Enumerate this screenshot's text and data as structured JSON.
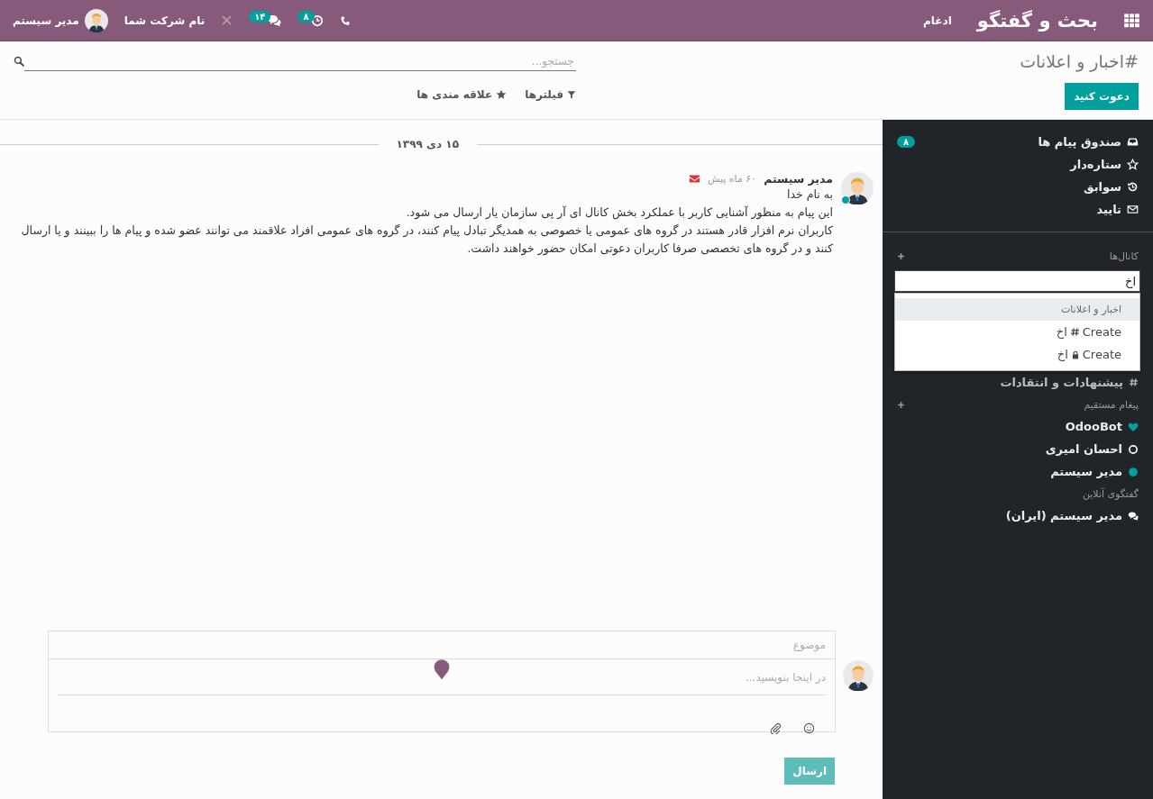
{
  "navbar": {
    "app_title": "بحث و گفتگو",
    "menu_items": [
      "ادغام"
    ],
    "activity_count": "۸",
    "messages_count": "۱۴",
    "company": "نام شرکت شما",
    "user": "مدیر سیستم"
  },
  "control_panel": {
    "title": "#اخبار و اعلانات",
    "invite_button": "دعوت کنید",
    "search": {
      "placeholder": "جستجو..."
    },
    "filters": [
      {
        "kind": "filter",
        "label": "فیلترها"
      },
      {
        "kind": "favorites",
        "label": "علاقه مندی ها"
      }
    ]
  },
  "sidebar": {
    "mailboxes": [
      {
        "kind": "inbox",
        "label": "صندوق پیام ها",
        "counter": "۸"
      },
      {
        "kind": "starred",
        "label": "ستاره‌دار"
      },
      {
        "kind": "history",
        "label": "سوابق"
      },
      {
        "kind": "moderation",
        "label": "تایید"
      }
    ],
    "channels": {
      "heading": "کانال‌ها",
      "search_value": "اخ",
      "suggestions": [
        {
          "kind": "match",
          "label": "اخبار و اعلانات",
          "selected": true
        },
        {
          "kind": "create_public",
          "label": "Create",
          "name": "اخ",
          "selected": false
        },
        {
          "kind": "create_private",
          "label": "Create",
          "name": "اخ",
          "selected": false
        }
      ],
      "items": [
        {
          "label": "پیشنهادات و انتقادات"
        }
      ]
    },
    "direct": {
      "heading": "پیغام مستقیم",
      "items": [
        {
          "kind": "bot",
          "label": "OdooBot"
        },
        {
          "kind": "offline",
          "label": "احسان امیری"
        },
        {
          "kind": "online",
          "label": "مدیر سیستم"
        }
      ]
    },
    "livechat": {
      "heading": "گفتگوی آنلاین",
      "items": [
        {
          "label": "مدیر سیستم (ایران)"
        }
      ]
    }
  },
  "thread": {
    "date": "۱۵ دی ۱۳۹۹",
    "messages": [
      {
        "author": "مدیر سیستم",
        "time": "۶۰ ماه پیش",
        "online": true,
        "lines": [
          "به نام خدا",
          "این پیام به منظور آشنایی کاربر با عملکرد بخش کانال ای آر پی سازمان یار ارسال می شود.",
          "کاربران نرم افزار قادر هستند در گروه های عمومی یا خصوصی به همدیگر تبادل پیام کنند، در گروه های عمومی افراد علاقمند می توانند عضو شده و پیام ها را ببینند و یا ارسال کنند و در گروه های تخصصی صرفا کاربران دعوتی امکان حضور خواهند داشت."
        ]
      }
    ]
  },
  "composer": {
    "subject_placeholder": "موضوع",
    "body_placeholder": "در اینجا بنویسید...",
    "send_button": "ارسال"
  }
}
